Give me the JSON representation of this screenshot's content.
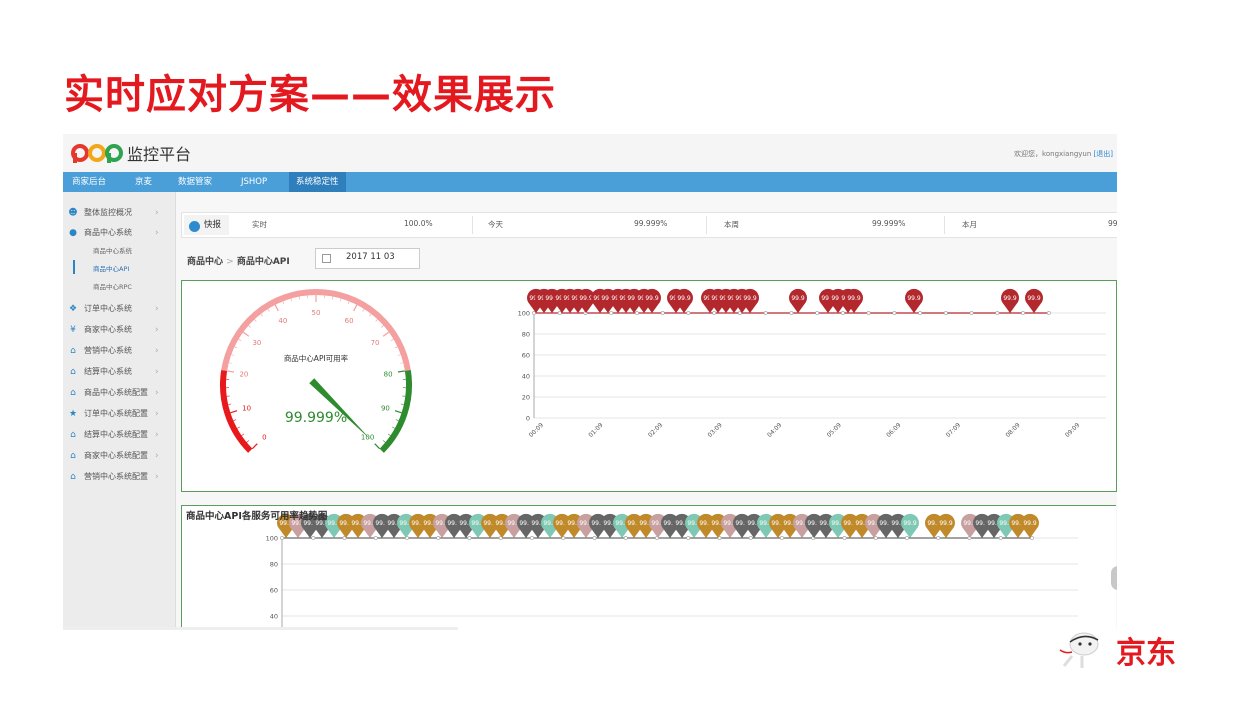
{
  "slide": {
    "title": "实时应对方案——效果展示"
  },
  "app": {
    "name": "监控平台",
    "welcome_text": "欢迎您，kongxiangyun",
    "logout_label": "[退出]"
  },
  "nav": {
    "items": [
      {
        "label": "商家后台"
      },
      {
        "label": "京麦"
      },
      {
        "label": "数据管家"
      },
      {
        "label": "JSHOP"
      },
      {
        "label": "系统稳定性"
      }
    ]
  },
  "sidebar": {
    "items": [
      {
        "label": "整体监控概况",
        "icon": "user-group-icon"
      },
      {
        "label": "商品中心系统",
        "icon": "user-icon"
      },
      {
        "label": "订单中心系统",
        "icon": "dropbox-icon"
      },
      {
        "label": "商家中心系统",
        "icon": "yen-icon"
      },
      {
        "label": "营销中心系统",
        "icon": "bank-icon"
      },
      {
        "label": "结算中心系统",
        "icon": "bank-icon"
      },
      {
        "label": "商品中心系统配置",
        "icon": "bank-icon"
      },
      {
        "label": "订单中心系统配置",
        "icon": "badge-icon"
      },
      {
        "label": "结算中心系统配置",
        "icon": "bank-icon"
      },
      {
        "label": "商家中心系统配置",
        "icon": "bank-icon"
      },
      {
        "label": "营销中心系统配置",
        "icon": "bank-icon"
      }
    ],
    "subitems": [
      {
        "label": "商品中心系统"
      },
      {
        "label": "商品中心API"
      },
      {
        "label": "商品中心RPC"
      }
    ]
  },
  "quick": {
    "label": "快报",
    "cells": [
      {
        "label": "实时",
        "value": "100.0%"
      },
      {
        "label": "今天",
        "value": "99.999%"
      },
      {
        "label": "本周",
        "value": "99.999%"
      },
      {
        "label": "本月",
        "value": "99"
      }
    ]
  },
  "breadcrumb": {
    "part1": "商品中心",
    "sep": ">",
    "part2": "商品中心API"
  },
  "date": {
    "value": "2017 11 03"
  },
  "gauge": {
    "title": "商品中心API可用率",
    "value_text": "99.999%",
    "value": 99.999,
    "min": 0,
    "max": 100,
    "ticks": [
      "0",
      "10",
      "20",
      "30",
      "40",
      "50",
      "60",
      "70",
      "80",
      "90",
      "100"
    ],
    "colors": {
      "low": "#e8191c",
      "mid": "#f4a0a0",
      "high": "#2e8b2e"
    }
  },
  "chart_data": [
    {
      "type": "line",
      "x": [
        "00:09",
        "01:09",
        "02:09",
        "03:09",
        "04:09",
        "05:09",
        "06:09",
        "07:09",
        "08:09",
        "09:09"
      ],
      "ylim": [
        0,
        100
      ],
      "yticks": [
        "0",
        "20",
        "40",
        "60",
        "80",
        "100"
      ],
      "series": [
        {
          "values": [
            100,
            100,
            100,
            100,
            100,
            100,
            100,
            100,
            100,
            100,
            100,
            100,
            100,
            100,
            100,
            100,
            100,
            100,
            100,
            100,
            100
          ],
          "color": "#b3282d"
        }
      ],
      "marker_label": "99.9",
      "marker_color": "#b3282d"
    },
    {
      "type": "line",
      "title": "商品中心API各服务可用率趋势图",
      "ylim": [
        40,
        100
      ],
      "yticks": [
        "40",
        "60",
        "80",
        "100"
      ],
      "series": [
        {
          "values": [
            100,
            100,
            100,
            100,
            100,
            100,
            100,
            100,
            100,
            100,
            100,
            100,
            100,
            100,
            100,
            100,
            100,
            100,
            100,
            100,
            100,
            100,
            100,
            100,
            100
          ],
          "color": "#444444"
        }
      ],
      "marker_label": "99.9",
      "marker_colors": [
        "#c08a2b",
        "#7fc9b4",
        "#666666",
        "#c8a0a0"
      ]
    }
  ]
}
